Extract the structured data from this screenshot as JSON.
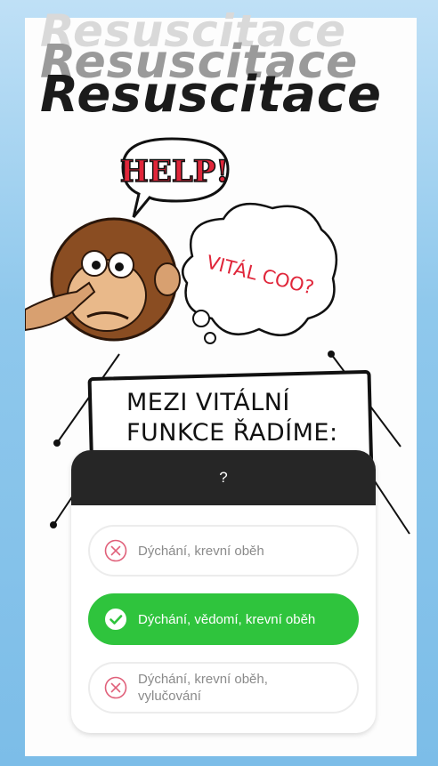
{
  "background": {
    "title": "Resuscitace",
    "help_text": "HELP!",
    "thought_text": "VITÁL COO?",
    "notice_lines": [
      "MEZI VITÁLNÍ",
      "FUNKCE ŘADÍME:"
    ]
  },
  "poll": {
    "header": "?",
    "options": [
      {
        "label": "Dýchání, krevní oběh",
        "state": "wrong",
        "icon": "x-circle-icon"
      },
      {
        "label": "Dýchání, vědomí, krevní oběh",
        "state": "correct",
        "icon": "check-circle-icon"
      },
      {
        "label": "Dýchání, krevní oběh, vylučování",
        "state": "wrong",
        "icon": "x-circle-icon"
      }
    ]
  },
  "colors": {
    "correct": "#2fc43d",
    "wrong_icon": "#e0607a",
    "header": "#262626",
    "frame": "#7cbde8"
  }
}
